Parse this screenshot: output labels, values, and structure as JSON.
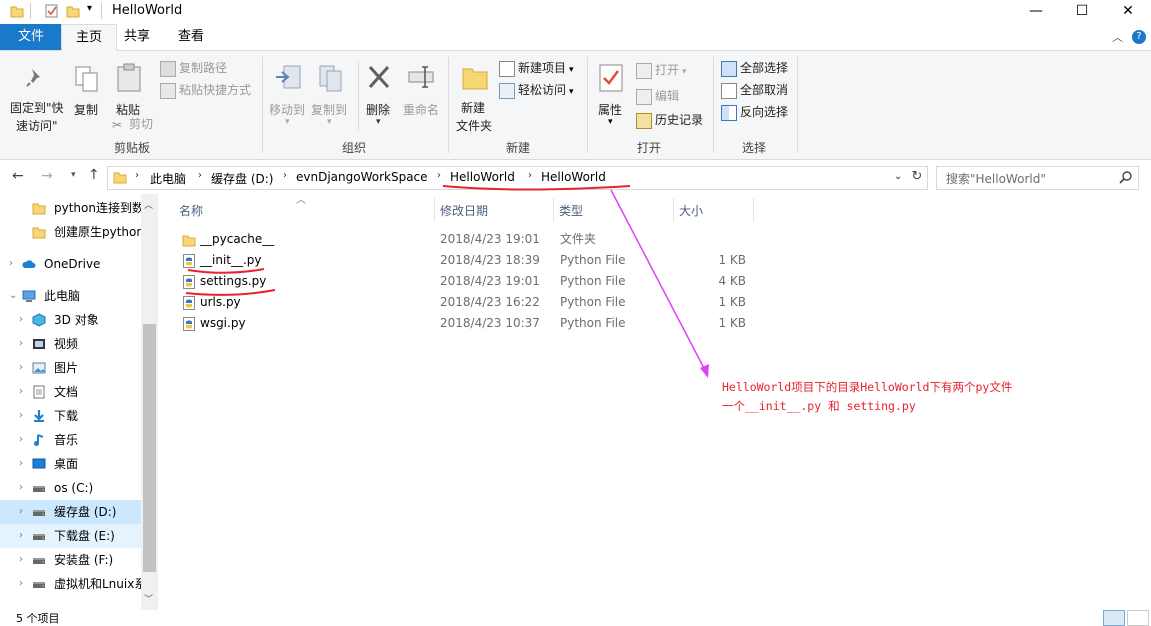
{
  "window": {
    "title": "HelloWorld",
    "minimize": "—",
    "maximize": "☐",
    "close": "✕"
  },
  "ribbon_tabs": [
    "文件",
    "主页",
    "共享",
    "查看"
  ],
  "ribbon": {
    "clipboard": {
      "pin_label_1": "固定到\"快",
      "pin_label_2": "速访问\"",
      "copy": "复制",
      "paste": "粘贴",
      "copy_path": "复制路径",
      "paste_shortcut": "粘贴快捷方式",
      "cut": "剪切",
      "group": "剪贴板"
    },
    "organize": {
      "move_to": "移动到",
      "copy_to": "复制到",
      "delete": "删除",
      "rename": "重命名",
      "group": "组织"
    },
    "new": {
      "new_folder_1": "新建",
      "new_folder_2": "文件夹",
      "new_item": "新建项目",
      "easy_access": "轻松访问",
      "group": "新建"
    },
    "open": {
      "properties": "属性",
      "open": "打开",
      "edit": "编辑",
      "history": "历史记录",
      "group": "打开"
    },
    "select": {
      "select_all": "全部选择",
      "select_none": "全部取消",
      "invert": "反向选择",
      "group": "选择"
    }
  },
  "address": {
    "crumbs": [
      "此电脑",
      "缓存盘 (D:)",
      "evnDjangoWorkSpace",
      "HelloWorld",
      "HelloWorld"
    ],
    "search_placeholder": "搜索\"HelloWorld\""
  },
  "sidebar": {
    "items": [
      {
        "label": "python连接到数",
        "icon": "folder-icon"
      },
      {
        "label": "创建原生python",
        "icon": "folder-icon"
      },
      {
        "label": "OneDrive",
        "icon": "cloud-icon"
      },
      {
        "label": "此电脑",
        "icon": "computer-icon"
      },
      {
        "label": "3D 对象",
        "icon": "cube-icon"
      },
      {
        "label": "视频",
        "icon": "video-icon"
      },
      {
        "label": "图片",
        "icon": "picture-icon"
      },
      {
        "label": "文档",
        "icon": "document-icon"
      },
      {
        "label": "下载",
        "icon": "download-icon"
      },
      {
        "label": "音乐",
        "icon": "music-icon"
      },
      {
        "label": "桌面",
        "icon": "desktop-icon"
      },
      {
        "label": "os (C:)",
        "icon": "drive-icon"
      },
      {
        "label": "缓存盘 (D:)",
        "icon": "drive-icon"
      },
      {
        "label": "下载盘 (E:)",
        "icon": "drive-icon"
      },
      {
        "label": "安装盘 (F:)",
        "icon": "drive-icon"
      },
      {
        "label": "虚拟机和Lnuix系",
        "icon": "drive-icon"
      }
    ]
  },
  "columns": [
    "名称",
    "修改日期",
    "类型",
    "大小"
  ],
  "files": [
    {
      "name": "__pycache__",
      "date": "2018/4/23 19:01",
      "type": "文件夹",
      "size": ""
    },
    {
      "name": "__init__.py",
      "date": "2018/4/23 18:39",
      "type": "Python File",
      "size": "1 KB"
    },
    {
      "name": "settings.py",
      "date": "2018/4/23 19:01",
      "type": "Python File",
      "size": "4 KB"
    },
    {
      "name": "urls.py",
      "date": "2018/4/23 16:22",
      "type": "Python File",
      "size": "1 KB"
    },
    {
      "name": "wsgi.py",
      "date": "2018/4/23 10:37",
      "type": "Python File",
      "size": "1 KB"
    }
  ],
  "annotation": {
    "line1": "HelloWorld项目下的目录HelloWorld下有两个py文件",
    "line2": "一个__init__.py 和 setting.py"
  },
  "status": {
    "count": "5 个项目"
  },
  "colors": {
    "accent": "#1979ca",
    "annotation": "#e8222f",
    "arrow": "#e040fb",
    "selection": "#cce8ff"
  }
}
